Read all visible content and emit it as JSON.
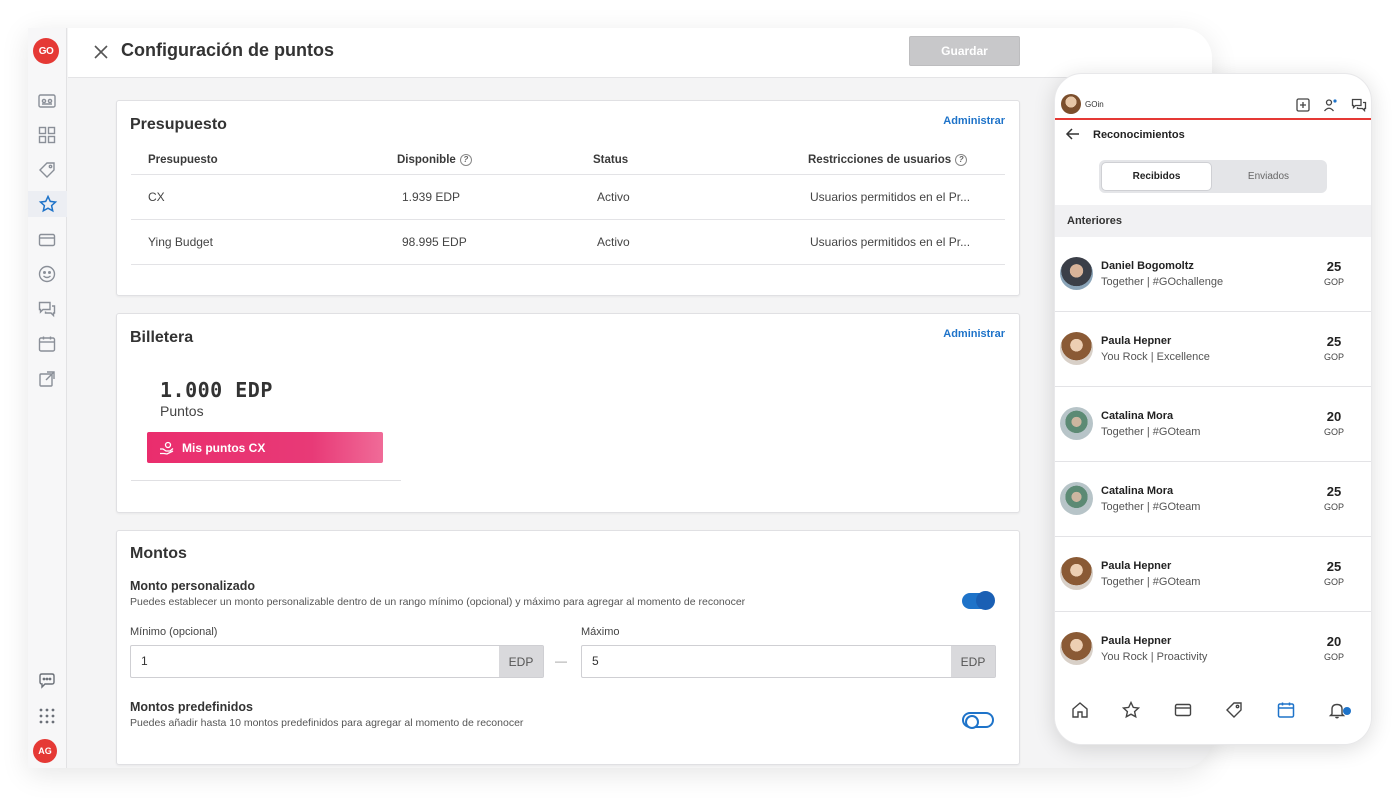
{
  "app": {
    "logo_text": "GO",
    "user_initials": "AG"
  },
  "header": {
    "title": "Configuración de puntos",
    "save_label": "Guardar"
  },
  "budget": {
    "title": "Presupuesto",
    "manage_label": "Administrar",
    "columns": [
      "Presupuesto",
      "Disponible",
      "Status",
      "Restricciones de usuarios"
    ],
    "rows": [
      {
        "name": "CX",
        "available": "1.939 EDP",
        "status": "Activo",
        "restrictions": "Usuarios permitidos en el Pr..."
      },
      {
        "name": "Ying Budget",
        "available": "98.995 EDP",
        "status": "Activo",
        "restrictions": "Usuarios permitidos en el Pr..."
      }
    ]
  },
  "wallet": {
    "title": "Billetera",
    "manage_label": "Administrar",
    "amount": "1.000 EDP",
    "unit_label": "Puntos",
    "button_label": "Mis puntos CX"
  },
  "amounts": {
    "title": "Montos",
    "custom": {
      "label": "Monto personalizado",
      "description": "Puedes establecer un monto personalizable dentro de un rango mínimo (opcional) y máximo para agregar al momento de reconocer",
      "enabled": true,
      "min_label": "Mínimo (opcional)",
      "min_value": "1",
      "max_label": "Máximo",
      "max_value": "5",
      "unit": "EDP",
      "separator": "—"
    },
    "predefined": {
      "label": "Montos predefinidos",
      "description": "Puedes añadir hasta 10 montos predefinidos para agregar al momento de reconocer",
      "enabled": false
    }
  },
  "phone": {
    "brand": "GOin",
    "title": "Reconocimientos",
    "tabs": {
      "received": "Recibidos",
      "sent": "Enviados"
    },
    "section": "Anteriores",
    "items": [
      {
        "name": "Daniel Bogomoltz",
        "subtitle": "Together | #GOchallenge",
        "points": "25",
        "unit": "GOP"
      },
      {
        "name": "Paula Hepner",
        "subtitle": "You Rock | Excellence",
        "points": "25",
        "unit": "GOP"
      },
      {
        "name": "Catalina Mora",
        "subtitle": "Together | #GOteam",
        "points": "20",
        "unit": "GOP"
      },
      {
        "name": "Catalina Mora",
        "subtitle": "Together | #GOteam",
        "points": "25",
        "unit": "GOP"
      },
      {
        "name": "Paula Hepner",
        "subtitle": "Together | #GOteam",
        "points": "25",
        "unit": "GOP"
      },
      {
        "name": "Paula Hepner",
        "subtitle": "You Rock | Proactivity",
        "points": "20",
        "unit": "GOP"
      }
    ]
  },
  "colors": {
    "accent": "#1e73c9",
    "brand_red": "#e53935",
    "wallet_pink": "#ea2d6d"
  }
}
